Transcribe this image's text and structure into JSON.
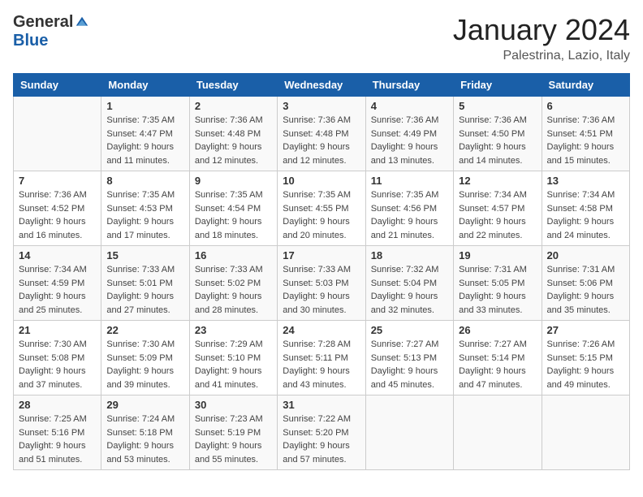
{
  "header": {
    "logo_general": "General",
    "logo_blue": "Blue",
    "title": "January 2024",
    "subtitle": "Palestrina, Lazio, Italy"
  },
  "columns": [
    "Sunday",
    "Monday",
    "Tuesday",
    "Wednesday",
    "Thursday",
    "Friday",
    "Saturday"
  ],
  "weeks": [
    [
      {
        "day": "",
        "info": ""
      },
      {
        "day": "1",
        "info": "Sunrise: 7:35 AM\nSunset: 4:47 PM\nDaylight: 9 hours\nand 11 minutes."
      },
      {
        "day": "2",
        "info": "Sunrise: 7:36 AM\nSunset: 4:48 PM\nDaylight: 9 hours\nand 12 minutes."
      },
      {
        "day": "3",
        "info": "Sunrise: 7:36 AM\nSunset: 4:48 PM\nDaylight: 9 hours\nand 12 minutes."
      },
      {
        "day": "4",
        "info": "Sunrise: 7:36 AM\nSunset: 4:49 PM\nDaylight: 9 hours\nand 13 minutes."
      },
      {
        "day": "5",
        "info": "Sunrise: 7:36 AM\nSunset: 4:50 PM\nDaylight: 9 hours\nand 14 minutes."
      },
      {
        "day": "6",
        "info": "Sunrise: 7:36 AM\nSunset: 4:51 PM\nDaylight: 9 hours\nand 15 minutes."
      }
    ],
    [
      {
        "day": "7",
        "info": "Sunrise: 7:36 AM\nSunset: 4:52 PM\nDaylight: 9 hours\nand 16 minutes."
      },
      {
        "day": "8",
        "info": "Sunrise: 7:35 AM\nSunset: 4:53 PM\nDaylight: 9 hours\nand 17 minutes."
      },
      {
        "day": "9",
        "info": "Sunrise: 7:35 AM\nSunset: 4:54 PM\nDaylight: 9 hours\nand 18 minutes."
      },
      {
        "day": "10",
        "info": "Sunrise: 7:35 AM\nSunset: 4:55 PM\nDaylight: 9 hours\nand 20 minutes."
      },
      {
        "day": "11",
        "info": "Sunrise: 7:35 AM\nSunset: 4:56 PM\nDaylight: 9 hours\nand 21 minutes."
      },
      {
        "day": "12",
        "info": "Sunrise: 7:34 AM\nSunset: 4:57 PM\nDaylight: 9 hours\nand 22 minutes."
      },
      {
        "day": "13",
        "info": "Sunrise: 7:34 AM\nSunset: 4:58 PM\nDaylight: 9 hours\nand 24 minutes."
      }
    ],
    [
      {
        "day": "14",
        "info": "Sunrise: 7:34 AM\nSunset: 4:59 PM\nDaylight: 9 hours\nand 25 minutes."
      },
      {
        "day": "15",
        "info": "Sunrise: 7:33 AM\nSunset: 5:01 PM\nDaylight: 9 hours\nand 27 minutes."
      },
      {
        "day": "16",
        "info": "Sunrise: 7:33 AM\nSunset: 5:02 PM\nDaylight: 9 hours\nand 28 minutes."
      },
      {
        "day": "17",
        "info": "Sunrise: 7:33 AM\nSunset: 5:03 PM\nDaylight: 9 hours\nand 30 minutes."
      },
      {
        "day": "18",
        "info": "Sunrise: 7:32 AM\nSunset: 5:04 PM\nDaylight: 9 hours\nand 32 minutes."
      },
      {
        "day": "19",
        "info": "Sunrise: 7:31 AM\nSunset: 5:05 PM\nDaylight: 9 hours\nand 33 minutes."
      },
      {
        "day": "20",
        "info": "Sunrise: 7:31 AM\nSunset: 5:06 PM\nDaylight: 9 hours\nand 35 minutes."
      }
    ],
    [
      {
        "day": "21",
        "info": "Sunrise: 7:30 AM\nSunset: 5:08 PM\nDaylight: 9 hours\nand 37 minutes."
      },
      {
        "day": "22",
        "info": "Sunrise: 7:30 AM\nSunset: 5:09 PM\nDaylight: 9 hours\nand 39 minutes."
      },
      {
        "day": "23",
        "info": "Sunrise: 7:29 AM\nSunset: 5:10 PM\nDaylight: 9 hours\nand 41 minutes."
      },
      {
        "day": "24",
        "info": "Sunrise: 7:28 AM\nSunset: 5:11 PM\nDaylight: 9 hours\nand 43 minutes."
      },
      {
        "day": "25",
        "info": "Sunrise: 7:27 AM\nSunset: 5:13 PM\nDaylight: 9 hours\nand 45 minutes."
      },
      {
        "day": "26",
        "info": "Sunrise: 7:27 AM\nSunset: 5:14 PM\nDaylight: 9 hours\nand 47 minutes."
      },
      {
        "day": "27",
        "info": "Sunrise: 7:26 AM\nSunset: 5:15 PM\nDaylight: 9 hours\nand 49 minutes."
      }
    ],
    [
      {
        "day": "28",
        "info": "Sunrise: 7:25 AM\nSunset: 5:16 PM\nDaylight: 9 hours\nand 51 minutes."
      },
      {
        "day": "29",
        "info": "Sunrise: 7:24 AM\nSunset: 5:18 PM\nDaylight: 9 hours\nand 53 minutes."
      },
      {
        "day": "30",
        "info": "Sunrise: 7:23 AM\nSunset: 5:19 PM\nDaylight: 9 hours\nand 55 minutes."
      },
      {
        "day": "31",
        "info": "Sunrise: 7:22 AM\nSunset: 5:20 PM\nDaylight: 9 hours\nand 57 minutes."
      },
      {
        "day": "",
        "info": ""
      },
      {
        "day": "",
        "info": ""
      },
      {
        "day": "",
        "info": ""
      }
    ]
  ]
}
